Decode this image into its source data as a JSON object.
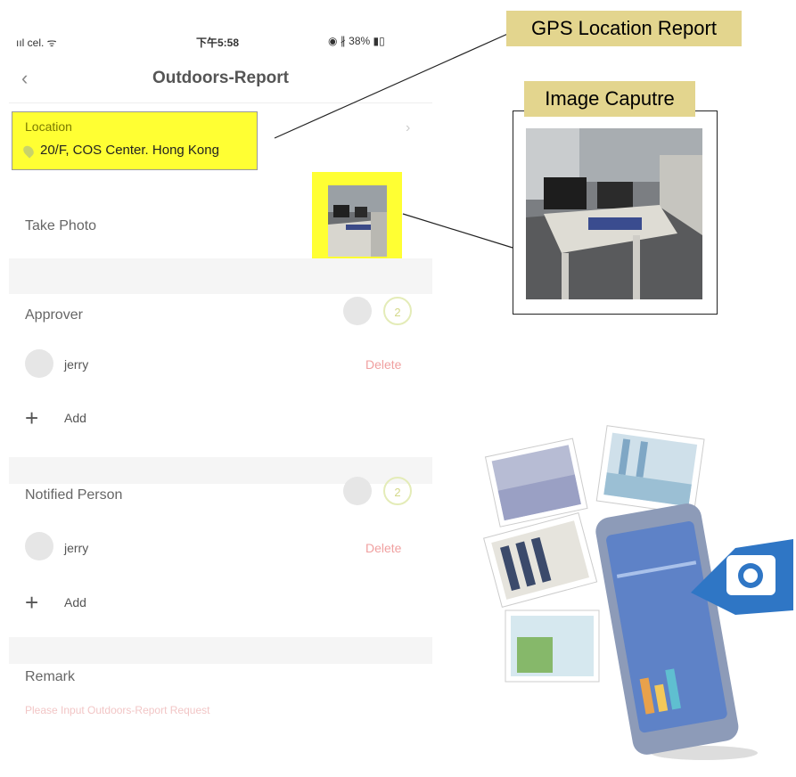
{
  "status_bar": {
    "signal": "ııl cel. ᯤ",
    "time": "下午5:58",
    "battery": "◉ ∦ 38% ▮▯"
  },
  "nav": {
    "back_icon": "chevron-left-icon",
    "title": "Outdoors-Report"
  },
  "location": {
    "label": "Location",
    "address": "20/F, COS Center. Hong Kong"
  },
  "photo": {
    "label": "Take Photo"
  },
  "approver": {
    "label": "Approver",
    "count": "2",
    "people": [
      {
        "name": "jerry",
        "delete_label": "Delete"
      }
    ],
    "add_label": "Add"
  },
  "notified": {
    "label": "Notified Person",
    "count": "2",
    "people": [
      {
        "name": "jerry",
        "delete_label": "Delete"
      }
    ],
    "add_label": "Add"
  },
  "remark": {
    "label": "Remark",
    "placeholder": "Please Input Outdoors-Report Request"
  },
  "callouts": {
    "gps": "GPS Location Report",
    "image": "Image Caputre"
  },
  "colors": {
    "highlight": "#ffff33",
    "callout_bg": "#e3d58e",
    "delete": "#f0a0a0"
  }
}
